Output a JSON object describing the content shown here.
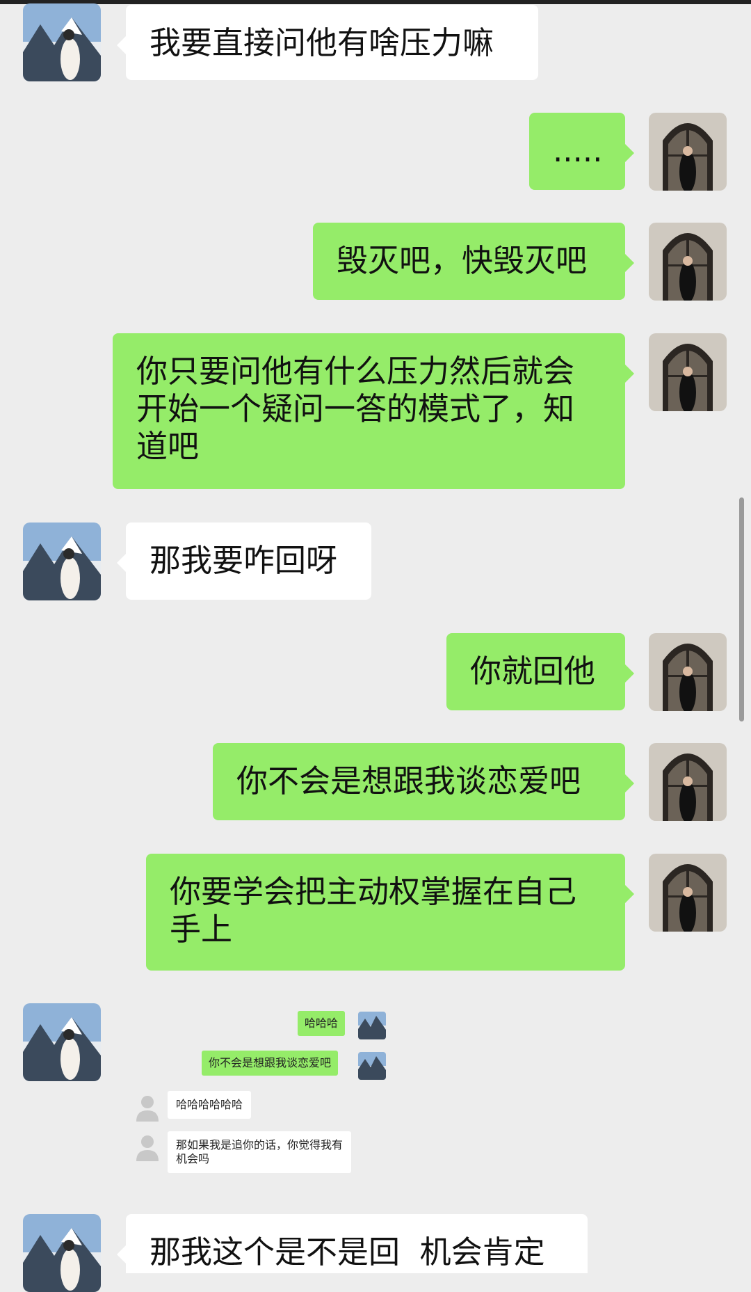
{
  "messages": [
    {
      "side": "in",
      "text": "我要直接问他有啥压力嘛"
    },
    {
      "side": "out",
      "text": "....."
    },
    {
      "side": "out",
      "text": "毁灭吧，快毁灭吧"
    },
    {
      "side": "out",
      "text": "你只要问他有什么压力然后就会开始一个疑问一答的模式了，知道吧"
    },
    {
      "side": "in",
      "text": "那我要咋回呀"
    },
    {
      "side": "out",
      "text": "你就回他"
    },
    {
      "side": "out",
      "text": "你不会是想跟我谈恋爱吧"
    },
    {
      "side": "out",
      "text": "你要学会把主动权掌握在自己手上"
    },
    {
      "side": "in",
      "text": "那我这个是不是回  机会肯定"
    }
  ],
  "embedded_screenshot": {
    "messages": [
      {
        "side": "out",
        "text": "哈哈哈"
      },
      {
        "side": "out",
        "text": "你不会是想跟我谈恋爱吧"
      },
      {
        "side": "in",
        "text": "哈哈哈哈哈哈"
      },
      {
        "side": "in",
        "text": "那如果我是追你的话，你觉得我有机会吗"
      }
    ]
  },
  "colors": {
    "background": "#ededed",
    "outgoing_bubble": "#95ec69",
    "incoming_bubble": "#ffffff"
  },
  "avatars": {
    "left": "mountain-landscape-avatar",
    "right": "gothic-window-avatar"
  }
}
